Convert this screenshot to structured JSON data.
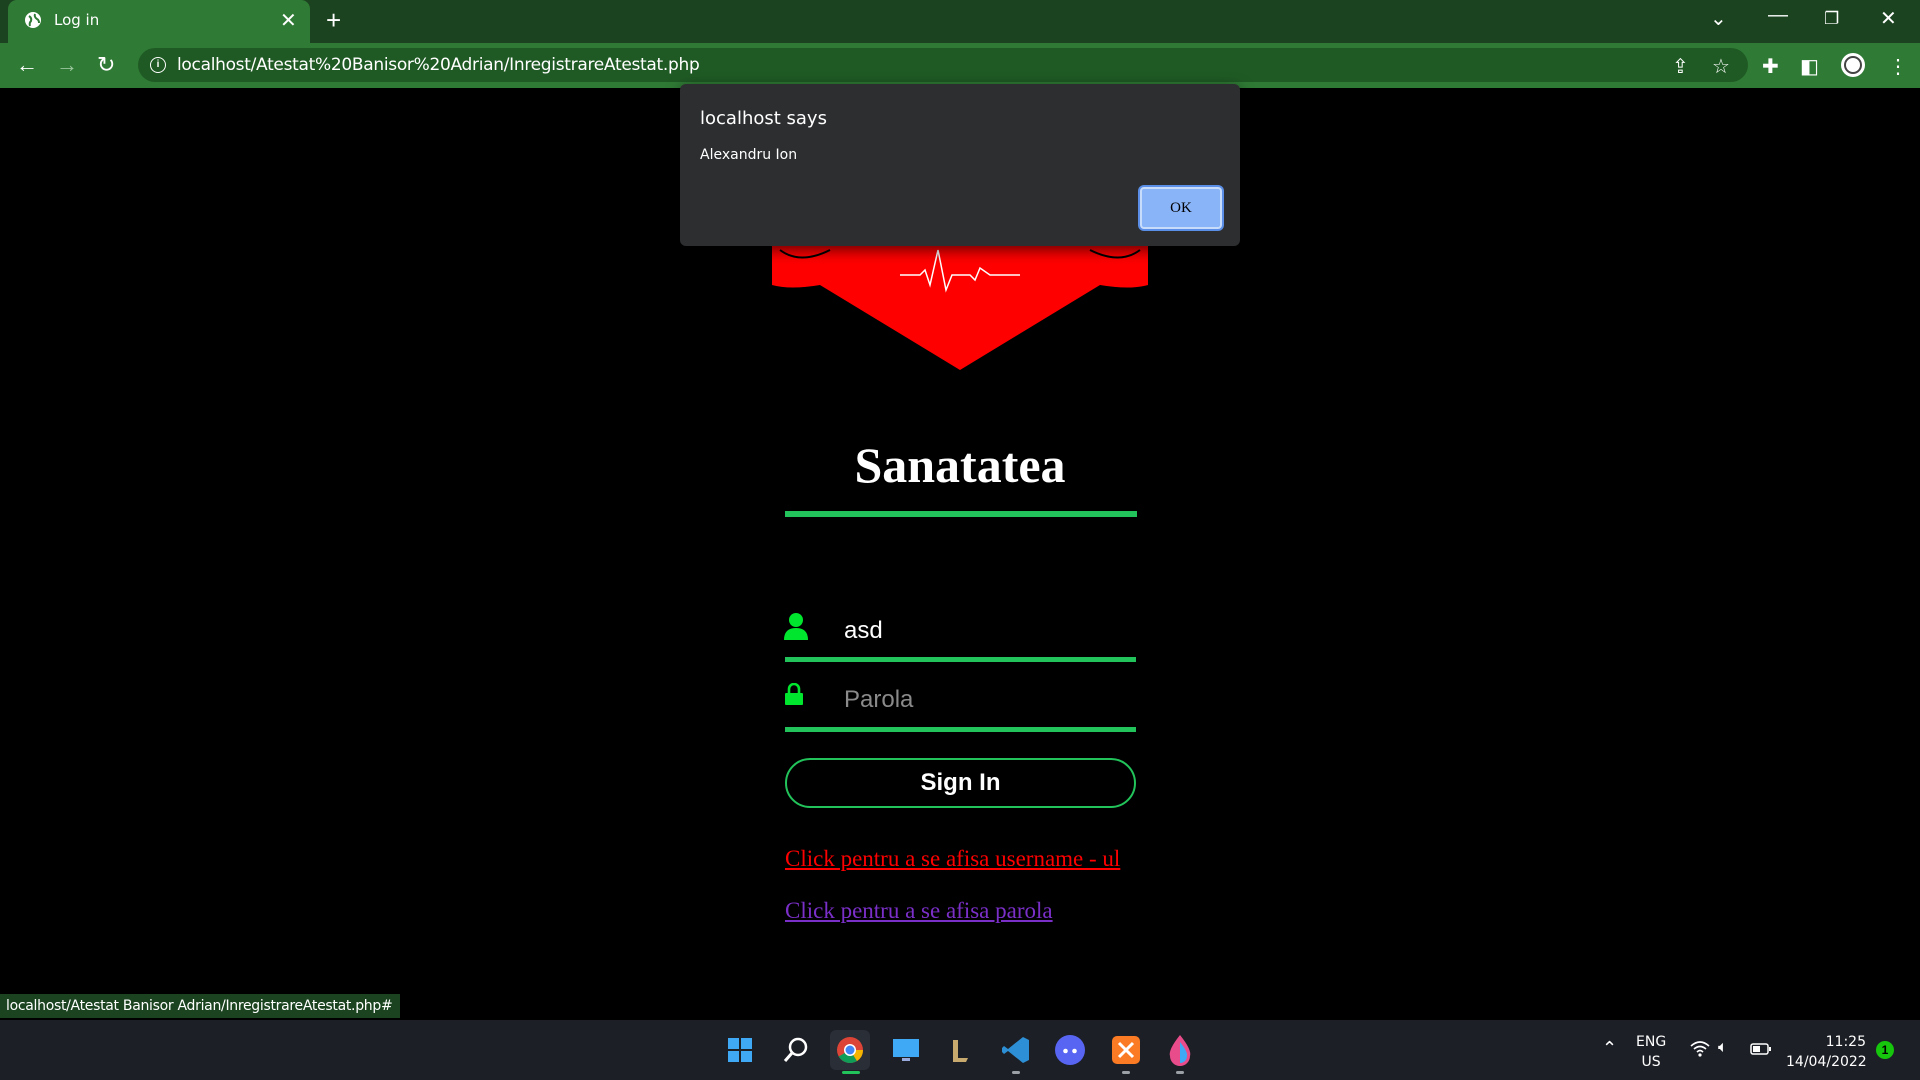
{
  "browser": {
    "tab_title": "Log in",
    "url": "localhost/Atestat%20Banisor%20Adrian/InregistrareAtestat.php",
    "new_tab": "+",
    "tab_close": "✕"
  },
  "dialog": {
    "title": "localhost says",
    "message": "Alexandru Ion",
    "ok_label": "OK"
  },
  "page": {
    "title": "Sanatatea",
    "username_value": "asd",
    "password_placeholder": "Parola",
    "signin_label": "Sign In",
    "link_show_username": "Click pentru a se afisa username - ul",
    "link_show_password": "Click pentru a se afisa parola"
  },
  "status_bar": {
    "url": "localhost/Atestat Banisor Adrian/InregistrareAtestat.php#"
  },
  "taskbar": {
    "lang_line1": "ENG",
    "lang_line2": "US",
    "time": "11:25",
    "date": "14/04/2022",
    "notification_count": "1"
  },
  "colors": {
    "accent_green": "#22c35a",
    "titlebar": "#1b4320",
    "toolbar": "#2f7a35",
    "link_red": "#ff0000",
    "link_purple": "#7b2fc9"
  }
}
